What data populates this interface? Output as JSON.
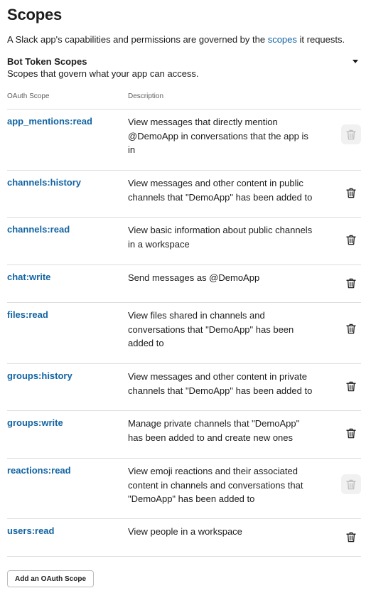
{
  "page": {
    "title": "Scopes",
    "intro_before": "A Slack app's capabilities and permissions are governed by the ",
    "intro_link": "scopes",
    "intro_after": " it requests."
  },
  "section": {
    "title": "Bot Token Scopes",
    "subtitle": "Scopes that govern what your app can access."
  },
  "table": {
    "col_scope": "OAuth Scope",
    "col_description": "Description",
    "rows": [
      {
        "scope": "app_mentions:read",
        "description": "View messages that directly mention @DemoApp in conversations that the app is in",
        "delete_disabled": true
      },
      {
        "scope": "channels:history",
        "description": "View messages and other content in public channels that \"DemoApp\" has been added to",
        "delete_disabled": false
      },
      {
        "scope": "channels:read",
        "description": "View basic information about public channels in a workspace",
        "delete_disabled": false
      },
      {
        "scope": "chat:write",
        "description": "Send messages as @DemoApp",
        "delete_disabled": false
      },
      {
        "scope": "files:read",
        "description": "View files shared in channels and conversations that \"DemoApp\" has been added to",
        "delete_disabled": false
      },
      {
        "scope": "groups:history",
        "description": "View messages and other content in private channels that \"DemoApp\" has been added to",
        "delete_disabled": false
      },
      {
        "scope": "groups:write",
        "description": "Manage private channels that \"DemoApp\" has been added to and create new ones",
        "delete_disabled": false
      },
      {
        "scope": "reactions:read",
        "description": "View emoji reactions and their associated content in channels and conversations that \"DemoApp\" has been added to",
        "delete_disabled": true
      },
      {
        "scope": "users:read",
        "description": "View people in a workspace",
        "delete_disabled": false
      }
    ]
  },
  "add_button": {
    "label": "Add an OAuth Scope"
  },
  "colors": {
    "link": "#1264a3",
    "text": "#1d1c1d",
    "muted": "#616061",
    "border": "#dddddd"
  },
  "icons": {
    "row_delete": "trash-icon",
    "collapse": "caret-down-icon"
  }
}
